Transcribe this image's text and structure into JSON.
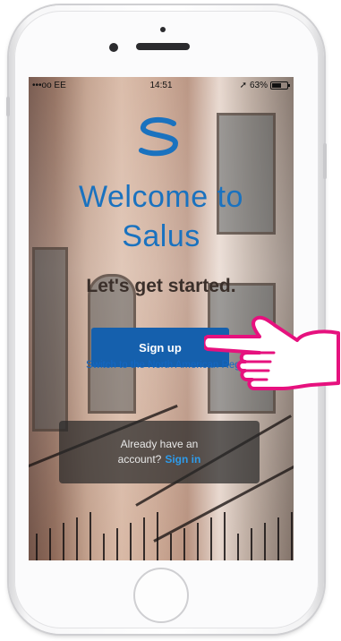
{
  "status_bar": {
    "carrier": "•••oo EE",
    "time": "14:51",
    "battery_percent": "63%",
    "battery_level": 0.63
  },
  "app": {
    "welcome_line1": "Welcome to",
    "welcome_line2": "Salus",
    "tagline": "Let's get started.",
    "signup_label": "Sign up",
    "switch_region_label": "Switch to the North American Region",
    "signin_prompt_line1": "Already have an",
    "signin_prompt_line2": "account?",
    "signin_label": "Sign in"
  },
  "colors": {
    "brand_blue": "#1a72bf",
    "button_blue": "#1560ad",
    "link_blue": "#2e9bea",
    "pointer_magenta": "#e6117e"
  },
  "icons": {
    "logo": "salus-s-logo-icon",
    "pointer": "pointing-hand-icon",
    "location": "location-arrow-icon",
    "battery": "battery-icon"
  }
}
